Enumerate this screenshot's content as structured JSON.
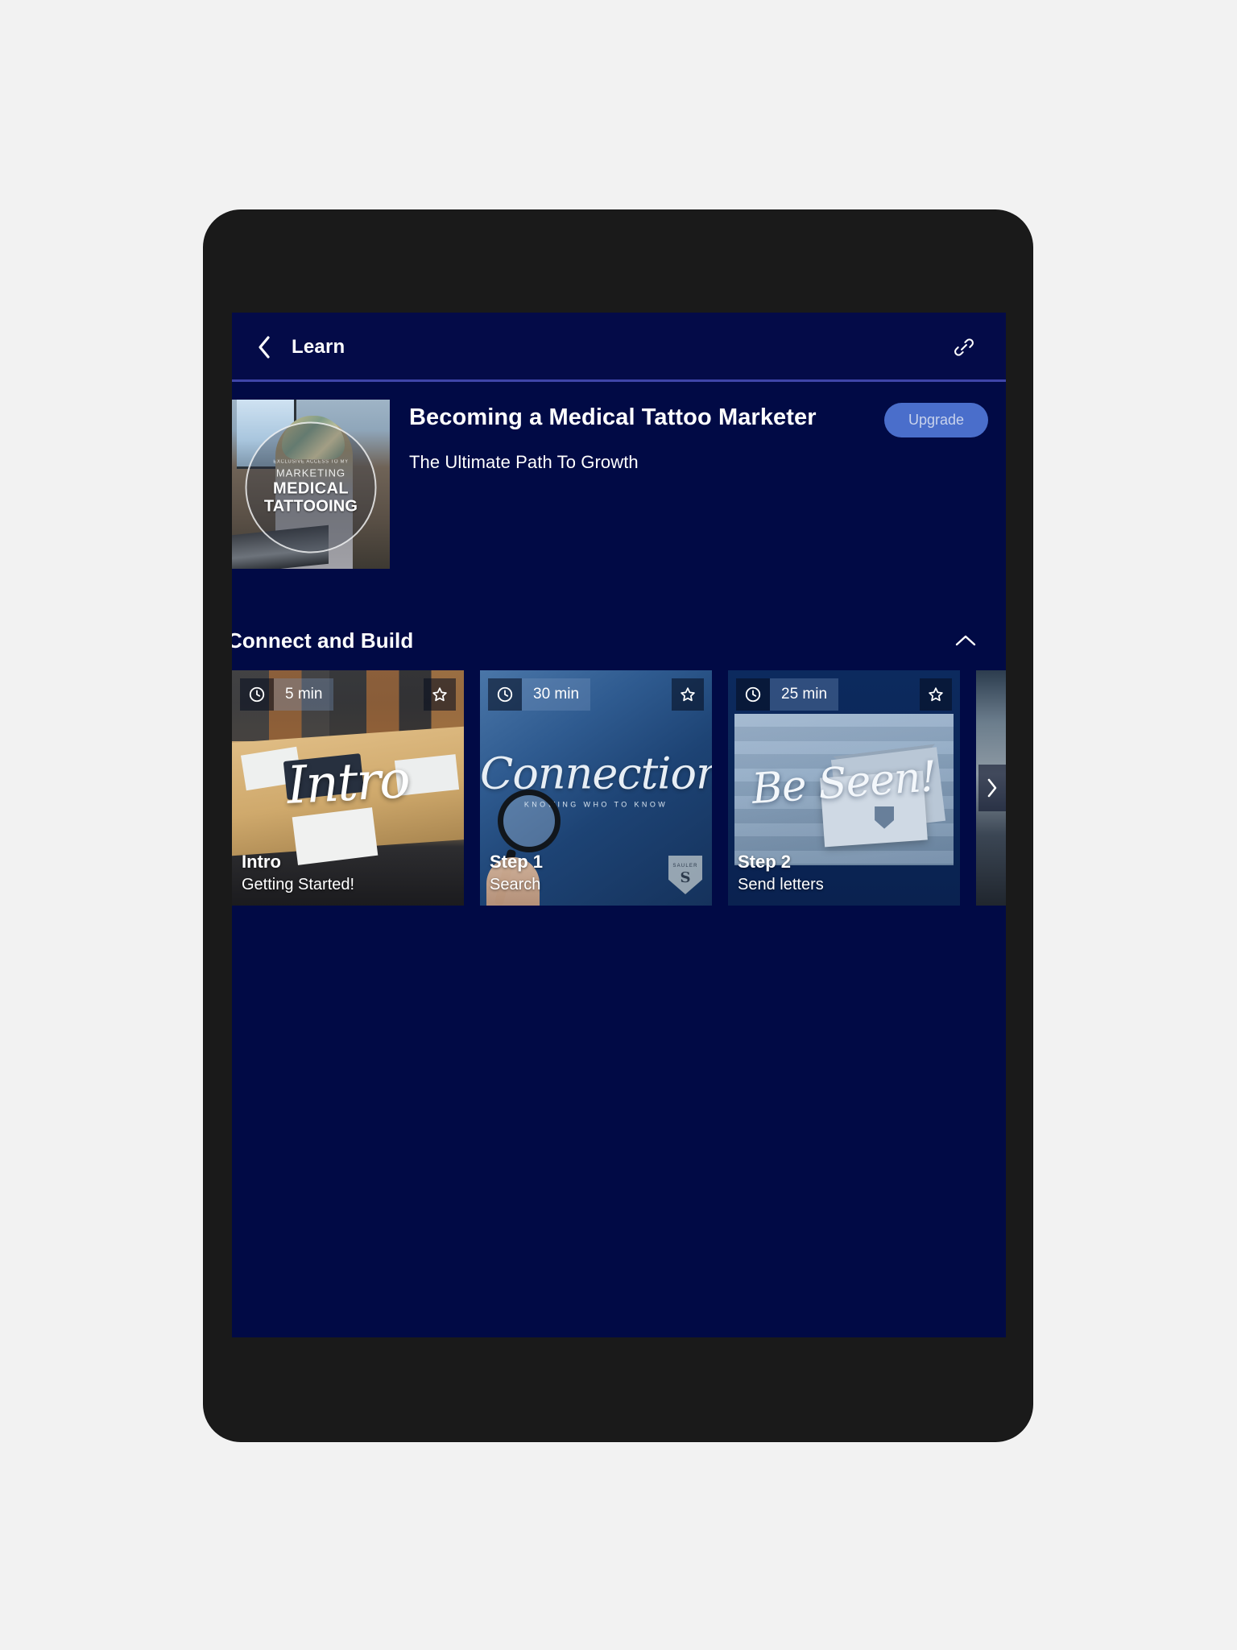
{
  "appbar": {
    "back_icon": "chevron-left-icon",
    "title": "Learn",
    "link_icon": "link-icon"
  },
  "course": {
    "title": "Becoming a Medical Tattoo Marketer",
    "subtitle": "The Ultimate Path To Growth",
    "upgrade_label": "Upgrade",
    "thumbnail": {
      "overlay_tagline": "EXCLUSIVE ACCESS TO MY",
      "overlay_marketing": "MARKETING",
      "overlay_line1": "MEDICAL",
      "overlay_line2": "TATTOOING"
    }
  },
  "section": {
    "title": "Connect and Build",
    "collapse_icon": "chevron-up-icon"
  },
  "carousel": {
    "next_icon": "chevron-right-icon",
    "clock_icon": "clock-icon",
    "star_icon": "star-outline-icon",
    "cards": [
      {
        "duration": "5 min",
        "title": "Intro",
        "subtitle": "Getting Started!",
        "artwork_script": "Intro"
      },
      {
        "duration": "30 min",
        "title": "Step 1",
        "subtitle": "Search",
        "artwork_script": "Connections",
        "artwork_sub": "KNOWING WHO TO KNOW",
        "artwork_badge_name": "SAULER",
        "artwork_badge_letter": "S"
      },
      {
        "duration": "25 min",
        "title": "Step 2",
        "subtitle": "Send letters",
        "artwork_script": "Be Seen!"
      }
    ]
  },
  "colors": {
    "screen_background": "#010a45",
    "appbar_background": "#040b48",
    "appbar_divider": "#3f45a8",
    "upgrade_button": "#4a6ecb",
    "upgrade_text": "#c9d3ec",
    "device_frame": "#1a1a1a",
    "page_background": "#f2f2f2",
    "text_primary": "#ffffff"
  }
}
